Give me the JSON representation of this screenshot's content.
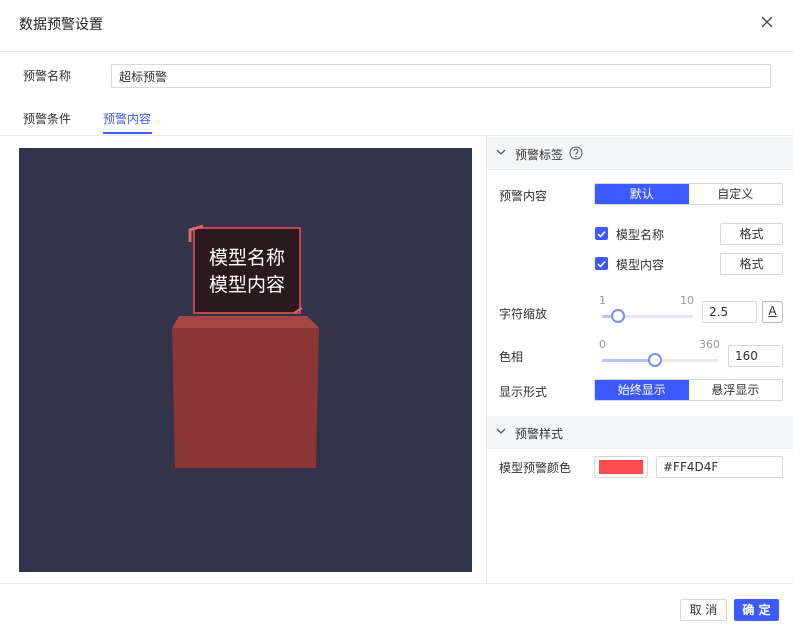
{
  "dialog": {
    "title": "数据预警设置",
    "close_icon": "close-icon"
  },
  "name": {
    "label": "预警名称",
    "value": "超标预警"
  },
  "tabs": [
    {
      "label": "预警条件",
      "active": false
    },
    {
      "label": "预警内容",
      "active": true
    }
  ],
  "preview": {
    "bg_color": "#33334a",
    "tag_lines": [
      "模型名称",
      "模型内容"
    ],
    "model_color": "#8b3535"
  },
  "label_section": {
    "title": "预警标签",
    "content_label": "预警内容",
    "content_options": [
      "默认",
      "自定义"
    ],
    "content_selected": "默认",
    "checks": [
      {
        "label": "模型名称",
        "checked": true,
        "format_label": "格式"
      },
      {
        "label": "模型内容",
        "checked": true,
        "format_label": "格式"
      }
    ],
    "scale": {
      "label": "字符缩放",
      "min": "1",
      "max": "10",
      "value": "2.5",
      "font_icon_text": "A"
    },
    "hue": {
      "label": "色相",
      "min": "0",
      "max": "360",
      "value": "160"
    },
    "display": {
      "label": "显示形式",
      "options": [
        "始终显示",
        "悬浮显示"
      ],
      "selected": "始终显示"
    }
  },
  "style_section": {
    "title": "预警样式",
    "color_label": "模型预警颜色",
    "color_value": "#FF4D4F"
  },
  "footer": {
    "cancel": "取 消",
    "ok": "确 定"
  },
  "colors": {
    "accent": "#3d5afe",
    "warning": "#FF4D4F"
  }
}
